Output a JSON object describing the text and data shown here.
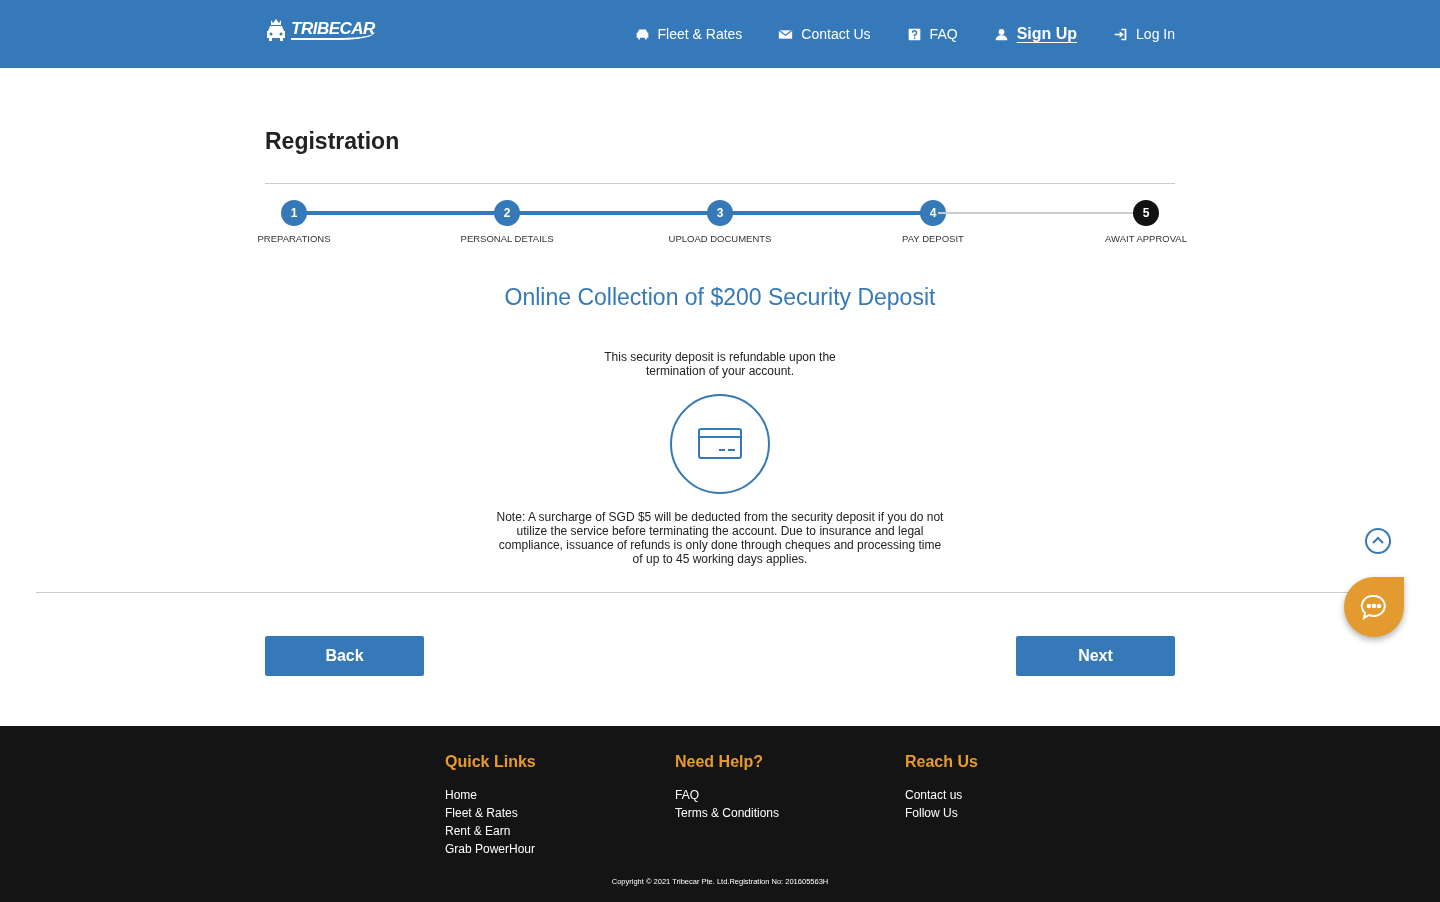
{
  "brand": {
    "name": "TRIBECAR"
  },
  "nav": [
    {
      "label": "Fleet & Rates",
      "selected": false
    },
    {
      "label": "Contact Us",
      "selected": false
    },
    {
      "label": "FAQ",
      "selected": false
    },
    {
      "label": "Sign Up",
      "selected": true
    },
    {
      "label": "Log In",
      "selected": false
    }
  ],
  "page_title": "Registration",
  "steps": [
    {
      "number": "1",
      "label": "PREPARATIONS",
      "done": true
    },
    {
      "number": "2",
      "label": "PERSONAL DETAILS",
      "done": true
    },
    {
      "number": "3",
      "label": "UPLOAD DOCUMENTS",
      "done": true
    },
    {
      "number": "4",
      "label": "PAY DEPOSIT",
      "done": true
    },
    {
      "number": "5",
      "label": "AWAIT APPROVAL",
      "done": false
    }
  ],
  "heading": "Online Collection of $200 Security Deposit",
  "intro": "This security deposit is refundable upon the termination of your account.",
  "note": "Note: A surcharge of SGD $5 will be deducted from the security deposit if you do not utilize the service before terminating the account. Due to insurance and legal compliance, issuance of refunds is only done through cheques and processing time of up to 45 working days applies.",
  "buttons": {
    "back": "Back",
    "next": "Next"
  },
  "footer": {
    "columns": [
      {
        "title": "Quick Links",
        "links": [
          "Home",
          "Fleet & Rates",
          "Rent & Earn",
          "Grab PowerHour"
        ]
      },
      {
        "title": "Need Help?",
        "links": [
          "FAQ",
          "Terms & Conditions"
        ]
      },
      {
        "title": "Reach Us",
        "links": [
          "Contact us",
          "Follow Us"
        ]
      }
    ],
    "copyright": "Copyright © 2021 Tribecar Pte. Ltd.Registration No: 201605563H"
  }
}
